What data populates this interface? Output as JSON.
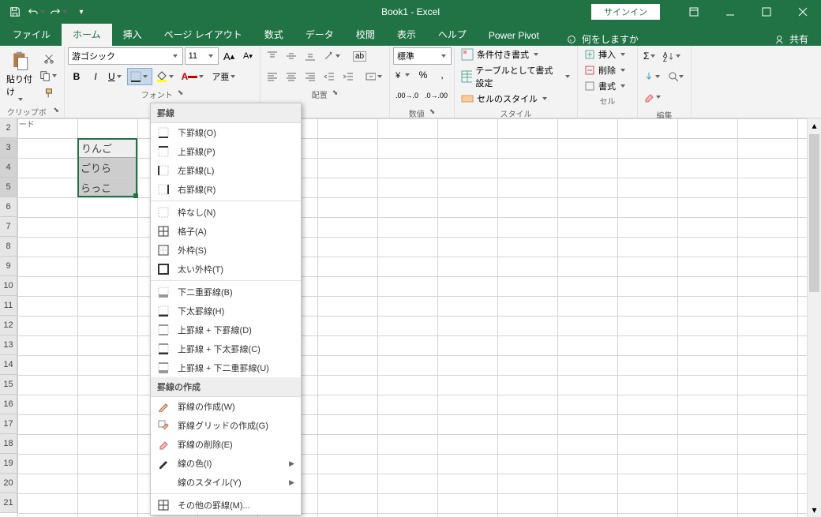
{
  "titlebar": {
    "title": "Book1 - Excel",
    "signin": "サインイン"
  },
  "tabs": {
    "file": "ファイル",
    "home": "ホーム",
    "insert": "挿入",
    "page_layout": "ページ レイアウト",
    "formulas": "数式",
    "data": "データ",
    "review": "校閲",
    "view": "表示",
    "help": "ヘルプ",
    "power_pivot": "Power Pivot",
    "tell_me": "何をしますか",
    "share": "共有"
  },
  "ribbon": {
    "clipboard": {
      "label": "クリップボード",
      "paste": "貼り付け"
    },
    "font": {
      "label": "フォント",
      "name": "游ゴシック",
      "size": "11"
    },
    "alignment": {
      "label": "配置",
      "wrap": "ab"
    },
    "number": {
      "label": "数値",
      "format": "標準"
    },
    "styles": {
      "label": "スタイル",
      "cond": "条件付き書式",
      "table": "テーブルとして書式設定",
      "cell": "セルのスタイル"
    },
    "cells": {
      "label": "セル",
      "insert": "挿入",
      "delete": "削除",
      "format": "書式"
    },
    "editing": {
      "label": "編集"
    }
  },
  "border_menu": {
    "header1": "罫線",
    "bottom": "下罫線(O)",
    "top": "上罫線(P)",
    "left": "左罫線(L)",
    "right": "右罫線(R)",
    "none": "枠なし(N)",
    "all": "格子(A)",
    "outside": "外枠(S)",
    "thick": "太い外枠(T)",
    "bottom_double": "下二重罫線(B)",
    "bottom_thick": "下太罫線(H)",
    "top_bottom": "上罫線 + 下罫線(D)",
    "top_bottom_thick": "上罫線 + 下太罫線(C)",
    "top_bottom_double": "上罫線 + 下二重罫線(U)",
    "header2": "罫線の作成",
    "draw": "罫線の作成(W)",
    "draw_grid": "罫線グリッドの作成(G)",
    "erase": "罫線の削除(E)",
    "color": "線の色(I)",
    "style": "線のスタイル(Y)",
    "more": "その他の罫線(M)..."
  },
  "cells_data": {
    "b3": "りんご",
    "b4": "ごりら",
    "b5": "らっこ"
  },
  "rows": [
    "2",
    "3",
    "4",
    "5",
    "6",
    "7",
    "8",
    "9",
    "10",
    "11",
    "12",
    "13",
    "14",
    "15",
    "16",
    "17",
    "18",
    "19",
    "20",
    "21"
  ]
}
